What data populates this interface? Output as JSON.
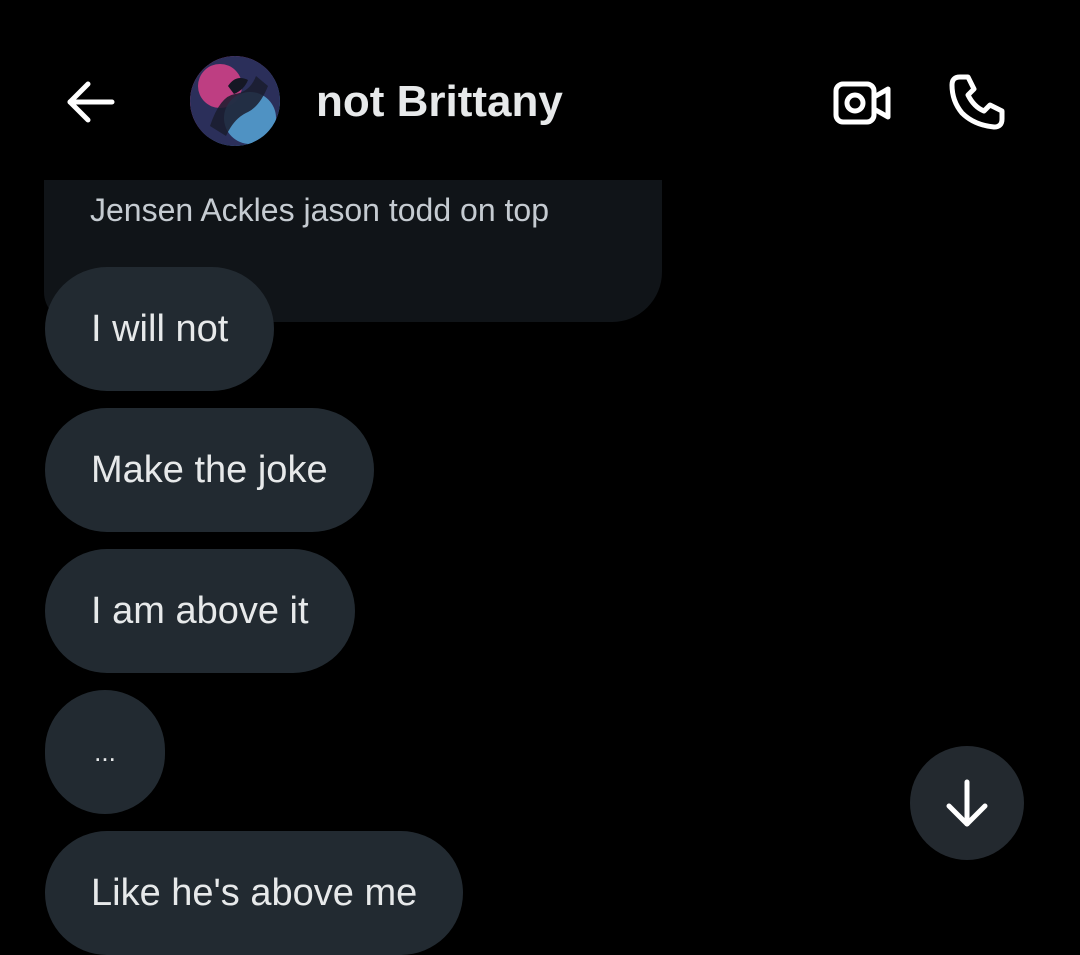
{
  "header": {
    "contact_name": "not Brittany",
    "back_icon": "arrow-left-icon",
    "video_icon": "video-camera-icon",
    "call_icon": "phone-icon"
  },
  "messages": {
    "quoted_text": "Jensen Ackles jason todd on top",
    "items": [
      "I will not",
      "Make the joke",
      "I am above it",
      "...",
      "Like he's above me"
    ]
  },
  "controls": {
    "scroll_icon": "arrow-down-icon"
  },
  "colors": {
    "background": "#000000",
    "bubble": "#222a31",
    "quoted_bubble": "#101418",
    "text": "#e7e9ea"
  }
}
